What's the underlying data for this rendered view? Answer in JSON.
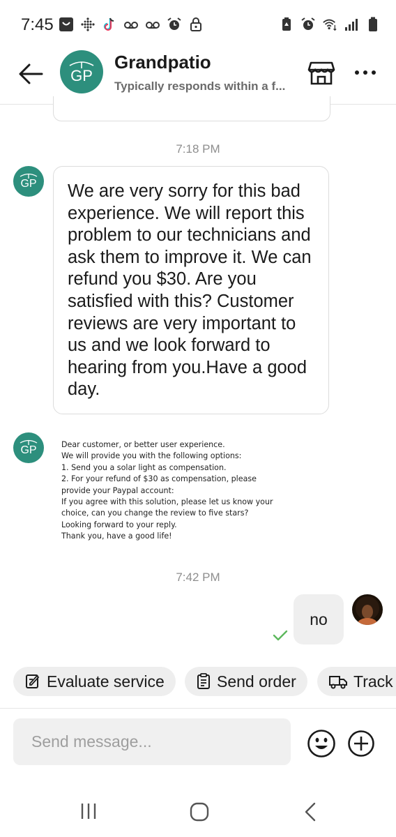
{
  "status_bar": {
    "time": "7:45"
  },
  "header": {
    "shop_name": "Grandpatio",
    "response_note": "Typically responds within a f...",
    "avatar_initials": "GP"
  },
  "chat": {
    "timestamp_1": "7:18 PM",
    "timestamp_2": "7:42 PM",
    "avatar_initials": "GP",
    "reply_text": "We are very sorry for this bad experience. We will report this problem to our technicians and ask them to improve it. We can refund you $30. Are you satisfied with this? Customer reviews are very important to us and we look forward to hearing from you.Have a good day.",
    "image_message_lines": [
      "Dear customer, or better user experience.",
      "We will provide you with the following options:",
      "1.   Send you a  solar light as compensation.",
      "2.   For your refund of $30 as compensation, please",
      "provide your Paypal account:",
      "If you agree with this solution, please let us know your",
      "choice, can you change the review to five stars?",
      "Looking forward to your reply.",
      "Thank you, have a good life!"
    ],
    "user_reply": "no"
  },
  "quick_actions": [
    {
      "label": "Evaluate service",
      "icon": "edit-icon"
    },
    {
      "label": "Send order",
      "icon": "order-icon"
    },
    {
      "label": "Track p",
      "icon": "truck-icon"
    }
  ],
  "composer": {
    "placeholder": "Send message..."
  },
  "colors": {
    "brand": "#2d8f7d",
    "bubble_border": "#dcdcdc",
    "outgoing_bubble": "#efefef",
    "check": "#5cb85c"
  }
}
